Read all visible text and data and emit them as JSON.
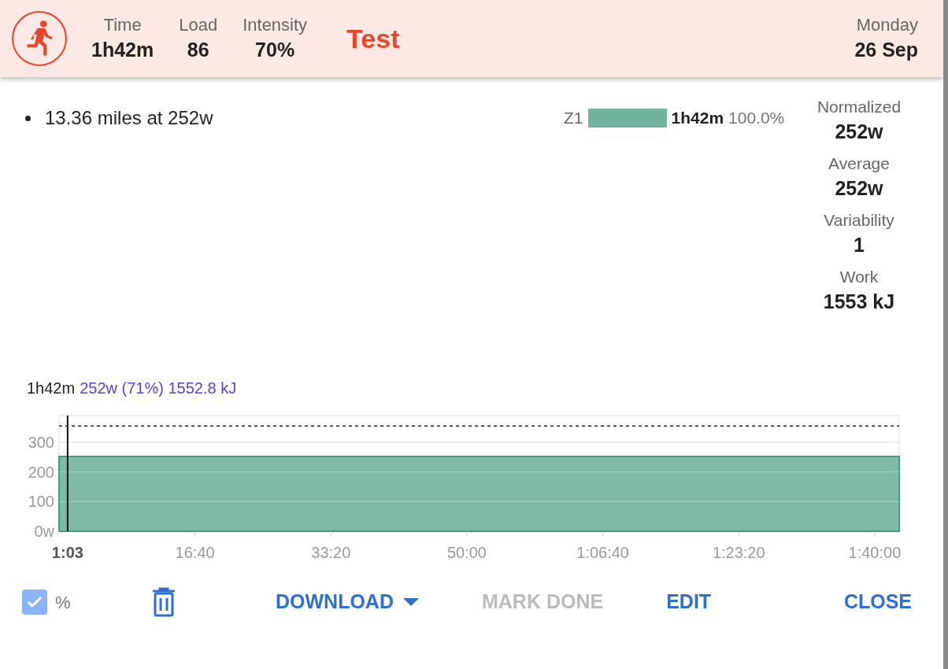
{
  "header": {
    "stats": [
      {
        "label": "Time",
        "value": "1h42m"
      },
      {
        "label": "Load",
        "value": "86"
      },
      {
        "label": "Intensity",
        "value": "70%"
      }
    ],
    "title": "Test",
    "day": "Monday",
    "date": "26 Sep"
  },
  "description": [
    "13.36 miles at 252w"
  ],
  "zones": [
    {
      "name": "Z1",
      "color": "#73b3a0",
      "time": "1h42m",
      "percent": "100.0%"
    }
  ],
  "metrics": [
    {
      "label": "Normalized",
      "value": "252w"
    },
    {
      "label": "Average",
      "value": "252w"
    },
    {
      "label": "Variability",
      "value": "1"
    },
    {
      "label": "Work",
      "value": "1553 kJ"
    }
  ],
  "chart": {
    "summary_time": "1h42m",
    "summary_power": "252w (71%) 1552.8 kJ",
    "chart_data": {
      "type": "area",
      "x": [
        0,
        6180
      ],
      "series": [
        {
          "color": "#7fbaa6",
          "values": [
            252,
            252
          ]
        }
      ],
      "xlim": [
        0,
        6180
      ],
      "ylim": [
        0,
        390
      ],
      "grid": true,
      "xticks": [
        {
          "value": 63,
          "label": "1:03"
        },
        {
          "value": 1000,
          "label": "16:40"
        },
        {
          "value": 2000,
          "label": "33:20"
        },
        {
          "value": 3000,
          "label": "50:00"
        },
        {
          "value": 4000,
          "label": "1:06:40"
        },
        {
          "value": 5000,
          "label": "1:23:20"
        },
        {
          "value": 6000,
          "label": "1:40:00"
        }
      ],
      "yticks": [
        {
          "value": 0,
          "label": "0w"
        },
        {
          "value": 100,
          "label": "100"
        },
        {
          "value": 200,
          "label": "200"
        },
        {
          "value": 300,
          "label": "300"
        }
      ],
      "ref_lines": [
        {
          "axis": "x",
          "value": 63
        },
        {
          "axis": "y",
          "value": 355
        }
      ]
    }
  },
  "footer": {
    "percent_checkbox": {
      "checked": true,
      "label": "%"
    },
    "buttons": [
      {
        "kind": "delete"
      },
      {
        "kind": "menu",
        "label": "DOWNLOAD",
        "disabled": false
      },
      {
        "kind": "text",
        "label": "MARK DONE",
        "disabled": true
      },
      {
        "kind": "text",
        "label": "EDIT",
        "disabled": false
      },
      {
        "kind": "text",
        "label": "CLOSE",
        "disabled": false
      }
    ]
  }
}
